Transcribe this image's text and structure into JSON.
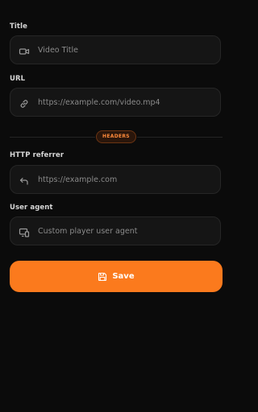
{
  "form": {
    "title_label": "Title",
    "title_placeholder": "Video Title",
    "url_label": "URL",
    "url_placeholder": "https://example.com/video.mp4",
    "headers_divider": "HEADERS",
    "referrer_label": "HTTP referrer",
    "referrer_placeholder": "https://example.com",
    "user_agent_label": "User agent",
    "user_agent_placeholder": "Custom player user agent",
    "save_label": "Save"
  },
  "icons": {
    "title": "video-camera-icon",
    "url": "link-icon",
    "referrer": "return-arrow-icon",
    "user_agent": "devices-icon",
    "save": "floppy-disk-icon"
  },
  "colors": {
    "background": "#0b0b0b",
    "field_background": "#151515",
    "accent": "#fb7a1d",
    "pill_text": "#ff8a3a"
  }
}
